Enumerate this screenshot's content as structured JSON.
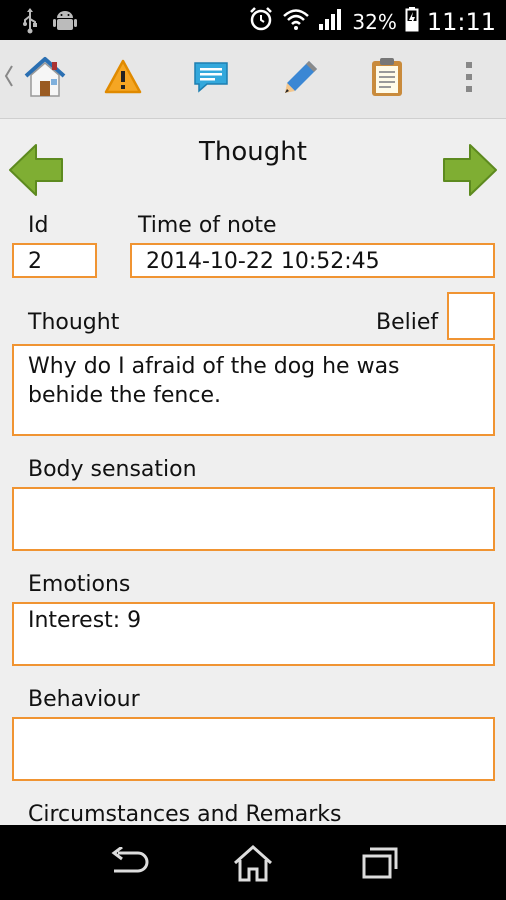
{
  "status_bar": {
    "battery_percent": "32%",
    "time": "11:11",
    "icons": [
      "usb-icon",
      "android-icon",
      "alarm-icon",
      "wifi-icon",
      "signal-icon",
      "battery-charging-icon"
    ]
  },
  "action_bar": {
    "icons": [
      "back-chevron-icon",
      "home-icon",
      "warning-icon",
      "chat-icon",
      "pencil-icon",
      "clipboard-icon",
      "overflow-menu-icon"
    ]
  },
  "page": {
    "title": "Thought"
  },
  "form": {
    "id_label": "Id",
    "id_value": "2",
    "time_label": "Time of note",
    "time_value": "2014-10-22 10:52:45",
    "thought_label": "Thought",
    "belief_label": "Belief",
    "belief_value": "",
    "thought_value": "Why do I afraid of the dog he was behide the fence.",
    "body_label": "Body sensation",
    "body_value": "",
    "emotions_label": "Emotions",
    "emotions_value": "Interest: 9",
    "behaviour_label": "Behaviour",
    "behaviour_value": "",
    "circumstances_label": "Circumstances and Remarks"
  },
  "colors": {
    "field_border": "#f09432",
    "arrow_green": "#7fae33"
  }
}
